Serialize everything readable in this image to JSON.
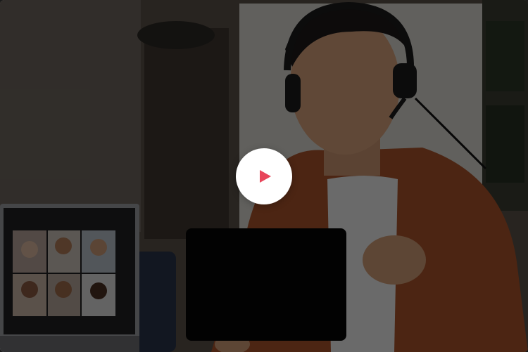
{
  "video": {
    "state": "paused",
    "play_icon": "play-icon",
    "accent_color": "#E8455A",
    "overlay_color": "rgba(0,0,0,0.55)"
  }
}
